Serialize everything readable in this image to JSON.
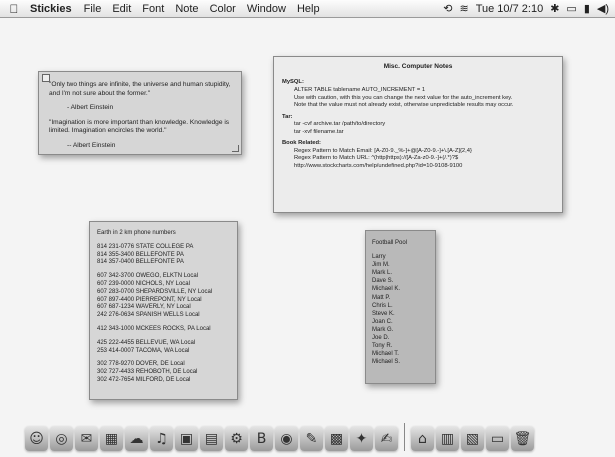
{
  "menubar": {
    "app_name": "Stickies",
    "menus": [
      "File",
      "Edit",
      "Font",
      "Note",
      "Color",
      "Window",
      "Help"
    ],
    "clock": "Tue 10/7  2:10"
  },
  "notes": {
    "quotes": {
      "quote1": "\"Only two things are infinite, the universe and human stupidity, and I'm not sure about the former.\"",
      "attr1": "- Albert Einstein",
      "quote2": "\"Imagination is more important than knowledge. Knowledge is limited. Imagination encircles the world.\"",
      "attr2": "-- Albert Einstein"
    },
    "misc": {
      "title": "Misc. Computer Notes",
      "sections": [
        {
          "heading": "MySQL:",
          "lines": [
            "ALTER TABLE tablename AUTO_INCREMENT = 1",
            "Use with caution, with this you can change the next value for the auto_increment key.",
            "Note that the value must not already exist, otherwise unpredictable results may occur."
          ]
        },
        {
          "heading": "Tar:",
          "lines": [
            "tar -cvf archive.tar /path/to/directory",
            "tar -xvf filename.tar"
          ]
        },
        {
          "heading": "Book Related:",
          "lines": [
            "Regex Pattern to Match Email: [A-Z0-9._%-]+@[A-Z0-9.-]+\\.[A-Z]{2,4}",
            "Regex Pattern to Match URL: ^(http|https)://[A-Za-z0-9.-]+(/.*)?$",
            "http://www.stockcharts.com/help/undefined.php?id=10-9108-9100"
          ]
        }
      ]
    },
    "area_codes": {
      "title": "Earth in 2 km phone numbers",
      "groups": [
        [
          "814 231-0776 STATE COLLEGE PA",
          "814 355-3400 BELLEFONTE PA",
          "814 357-0400 BELLEFONTE PA"
        ],
        [
          "607 342-3700 OWEGO, ELKTN Local",
          "607 239-0000 NICHOLS, NY Local",
          "607 283-0700 SHEPARDSVILLE, NY Local",
          "607 897-4400 PIERREPONT, NY Local",
          "607 687-1234 WAVERLY, NY Local",
          "242 276-0634 SPANISH WELLS Local"
        ],
        [
          "412 343-1000 MCKEES ROCKS, PA Local"
        ],
        [
          "425 222-4455 BELLEVUE, WA Local",
          "253 414-0007 TACOMA, WA Local"
        ],
        [
          "302 778-9270 DOVER, DE Local",
          "302 727-4433 REHOBOTH, DE Local",
          "302 472-7654 MILFORD, DE Local"
        ]
      ]
    },
    "football": {
      "title": "Football Pool",
      "names": [
        "Larry",
        "Jim M.",
        "Mark L.",
        "Dave S.",
        "Michael K.",
        "Matt P.",
        "Chris L.",
        "Steve K.",
        "Joan C.",
        "Mark G.",
        "Joe D.",
        "Tony R.",
        "Michael T.",
        "Michael S."
      ]
    }
  },
  "dock": {
    "apps": [
      {
        "icon": "finder-icon",
        "glyph": "☺"
      },
      {
        "icon": "safari-icon",
        "glyph": "◎"
      },
      {
        "icon": "mail-icon",
        "glyph": "✉"
      },
      {
        "icon": "ical-icon",
        "glyph": "▦"
      },
      {
        "icon": "ichat-icon",
        "glyph": "☁"
      },
      {
        "icon": "itunes-icon",
        "glyph": "♫"
      },
      {
        "icon": "iphoto-icon",
        "glyph": "▣"
      },
      {
        "icon": "preview-icon",
        "glyph": "▤"
      },
      {
        "icon": "system-prefs-icon",
        "glyph": "⚙"
      },
      {
        "icon": "bbedit-icon",
        "glyph": "B"
      },
      {
        "icon": "network-icon",
        "glyph": "◉"
      },
      {
        "icon": "utility-icon",
        "glyph": "✎"
      },
      {
        "icon": "photoshop-icon",
        "glyph": "▩"
      },
      {
        "icon": "dictionary-icon",
        "glyph": "✦"
      },
      {
        "icon": "stickies-icon",
        "glyph": "✍"
      }
    ],
    "docs": [
      {
        "icon": "home-folder-icon",
        "glyph": "⌂"
      },
      {
        "icon": "documents-icon",
        "glyph": "▥"
      },
      {
        "icon": "php-file-icon",
        "glyph": "▧"
      },
      {
        "icon": "folder-icon",
        "glyph": "▭"
      },
      {
        "icon": "trash-icon",
        "glyph": "🗑"
      }
    ]
  }
}
